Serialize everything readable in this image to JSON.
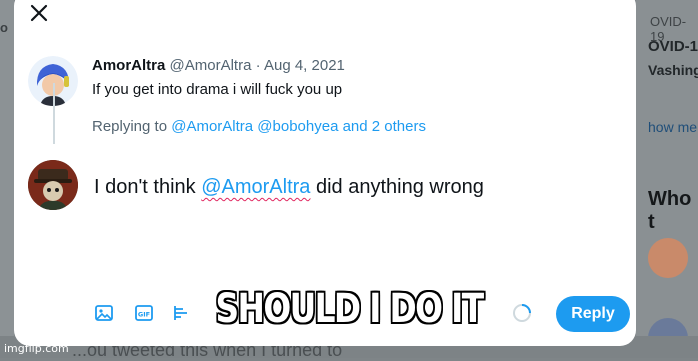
{
  "background": {
    "left_fragment": "o",
    "right_lines": [
      "OVID-19",
      "OVID-1",
      "Vashing",
      "how me",
      "Who t"
    ],
    "bottom_fragment": "...ou tweeted this when I turned to"
  },
  "original_tweet": {
    "display_name": "AmorAltra",
    "handle": "@AmorAltra",
    "separator": " · ",
    "date": "Aug 4, 2021",
    "text": "If you get into drama i will fuck you up"
  },
  "replying_to": {
    "prefix": "Replying to ",
    "users": "@AmorAltra @bobohyea",
    "and_others": " and 2 others"
  },
  "compose": {
    "before": "I don't think ",
    "mention": "@AmorAltra",
    "after": " did anything wrong"
  },
  "toolbar": {
    "reply_label": "Reply",
    "icons": [
      "image-icon",
      "gif-icon",
      "poll-icon"
    ]
  },
  "meme": {
    "caption": "SHOULD I DO IT",
    "watermark": "imgflip.com"
  },
  "colors": {
    "accent": "#1d9bf0",
    "text": "#0f1419",
    "muted": "#536471"
  }
}
